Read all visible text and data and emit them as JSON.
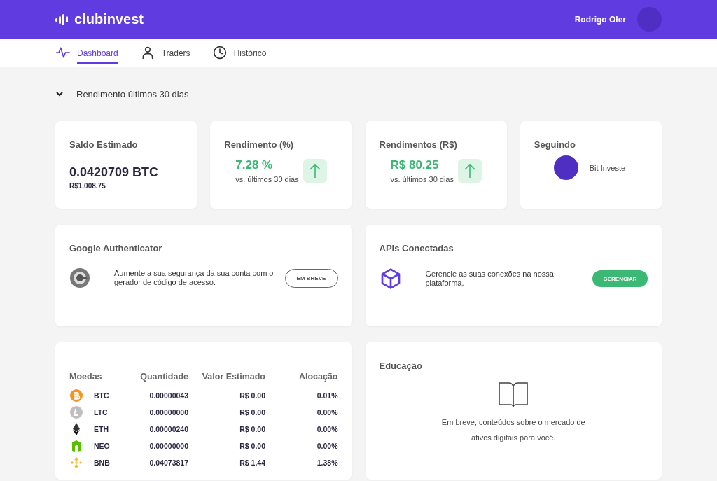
{
  "header": {
    "brand": "clubinvest",
    "user": "Rodrigo Oler"
  },
  "nav": [
    {
      "label": "Dashboard",
      "kind": "pulse",
      "selected": true
    },
    {
      "label": "Traders",
      "kind": "person",
      "selected": false
    },
    {
      "label": "Histórico",
      "kind": "clock",
      "selected": false
    }
  ],
  "section": {
    "title": "Rendimento últimos 30 dias",
    "expanded": true
  },
  "stats": [
    {
      "kind": "balance",
      "title": "Saldo Estimado",
      "value": "0.0420709 BTC",
      "sub": "R$1.008.75"
    },
    {
      "kind": "change",
      "title": "Rendimento (%)",
      "value": "7.28 %",
      "sub": "vs. últimos 30 dias",
      "rising": true
    },
    {
      "kind": "change",
      "title": "Rendimentos (R$)",
      "value": "R$ 80.25",
      "sub": "vs. últimos 30 dias",
      "rising": true
    },
    {
      "kind": "following",
      "title": "Seguindo",
      "name": "Bit Investe"
    }
  ],
  "features": [
    {
      "title": "Google Authenticator",
      "kind": "authenticator",
      "text": "Aumente a sua segurança da sua conta com o gerador de código de acesso.",
      "button": "EM BREVE",
      "disabled": true
    },
    {
      "title": "APIs Conectadas",
      "kind": "cube",
      "text": "Gerencie as suas conexões na nossa plataforma.",
      "button": "GERENCIAR",
      "disabled": false
    }
  ],
  "coins": {
    "columns": [
      "Moedas",
      "Quantidade",
      "Valor Estimado",
      "Alocação"
    ],
    "rows": [
      {
        "kind": "btc",
        "symbol": "BTC",
        "amount": "0.00000043",
        "value": "R$ 0.00",
        "allocation": "0.01%"
      },
      {
        "kind": "ltc",
        "symbol": "LTC",
        "amount": "0.00000000",
        "value": "R$ 0.00",
        "allocation": "0.00%"
      },
      {
        "kind": "eth",
        "symbol": "ETH",
        "amount": "0.00000240",
        "value": "R$ 0.00",
        "allocation": "0.00%"
      },
      {
        "kind": "neo",
        "symbol": "NEO",
        "amount": "0.00000000",
        "value": "R$ 0.00",
        "allocation": "0.00%"
      },
      {
        "kind": "bnb",
        "symbol": "BNB",
        "amount": "0.04073817",
        "value": "R$ 1.44",
        "allocation": "1.38%"
      }
    ]
  },
  "education": {
    "title": "Educação",
    "text": "Em breve, conteúdos sobre o mercado de ativos digitais para você."
  }
}
